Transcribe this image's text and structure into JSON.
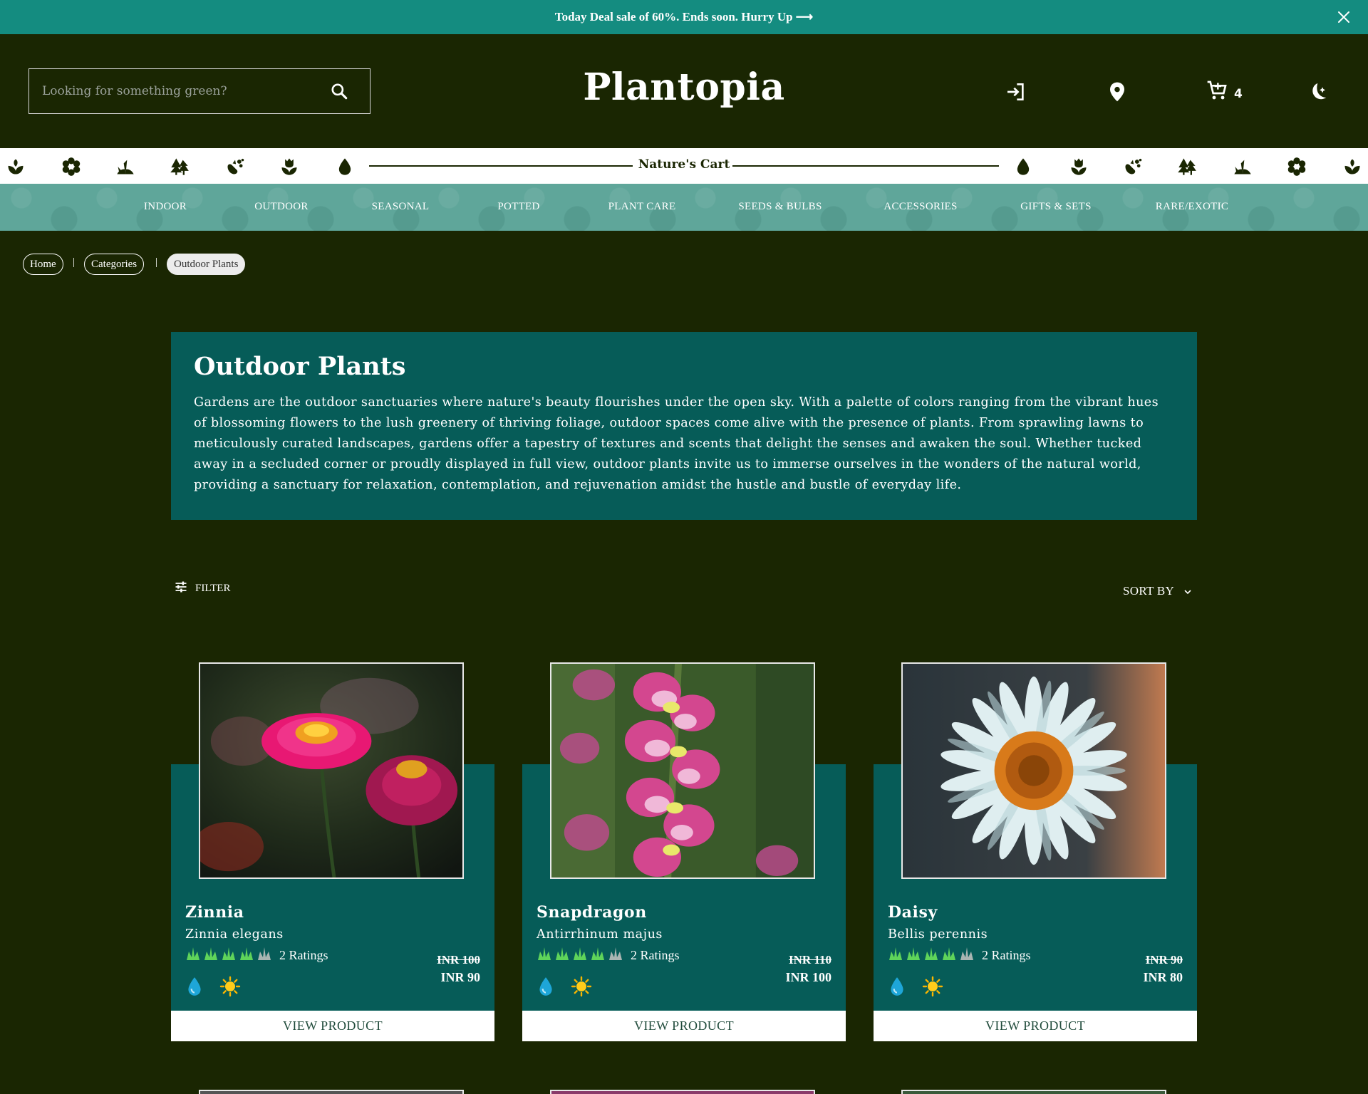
{
  "announcement": {
    "prefix": "Today Deal sale of ",
    "highlight": "60%",
    "suffix": ". Ends soon. Hurry Up ⟶",
    "close_icon": "close-icon"
  },
  "header": {
    "search_placeholder": "Looking for something green?",
    "logo": "Plantopia",
    "cart_count": "4",
    "icons": [
      "login-icon",
      "location-pin-icon",
      "cart-icon",
      "dark-mode-moon-icon"
    ]
  },
  "strip": {
    "title": "Nature's Cart",
    "icons": [
      "sprout-icon",
      "flower-icon",
      "grass-icon",
      "trees-icon",
      "seeds-icon",
      "tulip-icon",
      "water-drop-icon"
    ]
  },
  "nav": {
    "items": [
      "INDOOR",
      "OUTDOOR",
      "SEASONAL",
      "POTTED",
      "PLANT CARE",
      "SEEDS & BULBS",
      "ACCESSORIES",
      "GIFTS & SETS",
      "RARE/EXOTIC"
    ]
  },
  "breadcrumb": {
    "items": [
      "Home",
      "Categories",
      "Outdoor Plants"
    ],
    "separator": "|"
  },
  "intro": {
    "title": "Outdoor Plants",
    "description": "Gardens are the outdoor sanctuaries where nature's beauty flourishes under the open sky. With a palette of colors ranging from the vibrant hues of blossoming flowers to the lush greenery of thriving foliage, outdoor spaces come alive with the presence of plants. From sprawling lawns to meticulously curated landscapes, gardens offer a tapestry of textures and scents that delight the senses and awaken the soul. Whether tucked away in a secluded corner or proudly displayed in full view, outdoor plants invite us to immerse ourselves in the wonders of the natural world, providing a sanctuary for relaxation, contemplation, and rejuvenation amidst the hustle and bustle of everyday life."
  },
  "toolbar": {
    "filter_label": "FILTER",
    "sort_label": "SORT BY"
  },
  "products": [
    {
      "name": "Zinnia",
      "scientific": "Zinnia elegans",
      "rating_stars": 4,
      "rating_text": "2 Ratings",
      "old_price": "INR 100",
      "price": "INR 90",
      "button": "VIEW PRODUCT",
      "care_icons": [
        "water-drop-icon",
        "sun-icon"
      ]
    },
    {
      "name": "Snapdragon",
      "scientific": "Antirrhinum majus",
      "rating_stars": 4,
      "rating_text": "2 Ratings",
      "old_price": "INR 110",
      "price": "INR 100",
      "button": "VIEW PRODUCT",
      "care_icons": [
        "water-drop-icon",
        "sun-icon"
      ]
    },
    {
      "name": "Daisy",
      "scientific": "Bellis perennis",
      "rating_stars": 4,
      "rating_text": "2 Ratings",
      "old_price": "INR 90",
      "price": "INR 80",
      "button": "VIEW PRODUCT",
      "care_icons": [
        "water-drop-icon",
        "sun-icon"
      ]
    }
  ],
  "colors": {
    "background": "#1a2602",
    "announcement": "#148c80",
    "panel": "#065c58",
    "nav": "#5fa69a",
    "rating_star": "#5fd45a"
  }
}
